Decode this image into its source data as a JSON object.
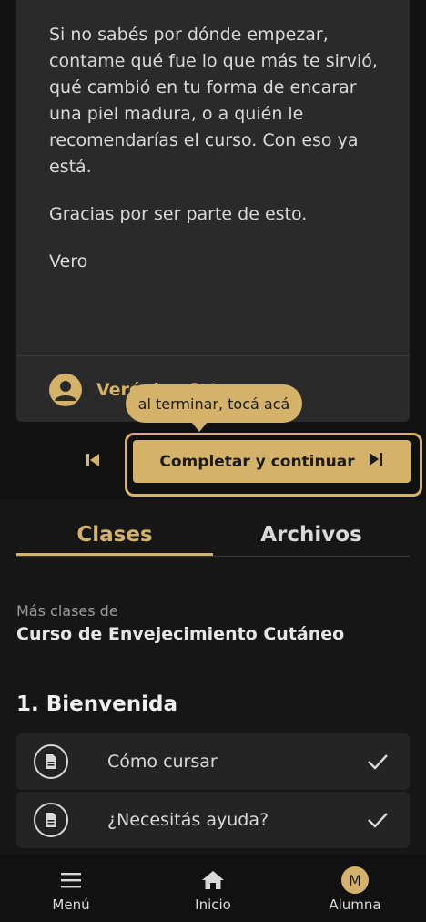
{
  "message": {
    "paragraphs": [
      "Si no sabés por dónde empezar, contame qué fue lo que más te sirvió, qué cambió en tu forma de encarar una piel madura, o a quién le recomendarías el curso. Con eso ya está.",
      "Gracias por ser parte de esto.",
      "Vero"
    ],
    "author_name": "Verónica Ort"
  },
  "tooltip": {
    "text": "al terminar, tocá acá"
  },
  "actions": {
    "prev_icon": "skip-previous-icon",
    "complete_label": "Completar y continuar",
    "complete_icon": "skip-next-icon"
  },
  "tabs": [
    {
      "label": "Clases",
      "active": true
    },
    {
      "label": "Archivos",
      "active": false
    }
  ],
  "course": {
    "more_label": "Más clases de",
    "name": "Curso de Envejecimiento Cutáneo"
  },
  "section": {
    "title": "1. Bienvenida",
    "lessons": [
      {
        "title": "Cómo cursar",
        "icon": "document-icon",
        "completed": true
      },
      {
        "title": "¿Necesitás ayuda?",
        "icon": "document-icon",
        "completed": true
      }
    ]
  },
  "bottom_nav": {
    "items": [
      {
        "label": "Menú",
        "icon": "hamburger-menu-icon"
      },
      {
        "label": "Inicio",
        "icon": "home-icon"
      },
      {
        "label": "Alumna",
        "icon": "avatar",
        "initial": "M"
      }
    ]
  },
  "colors": {
    "accent": "#d4b26a",
    "background": "#161616",
    "card": "#2a2a2a"
  }
}
